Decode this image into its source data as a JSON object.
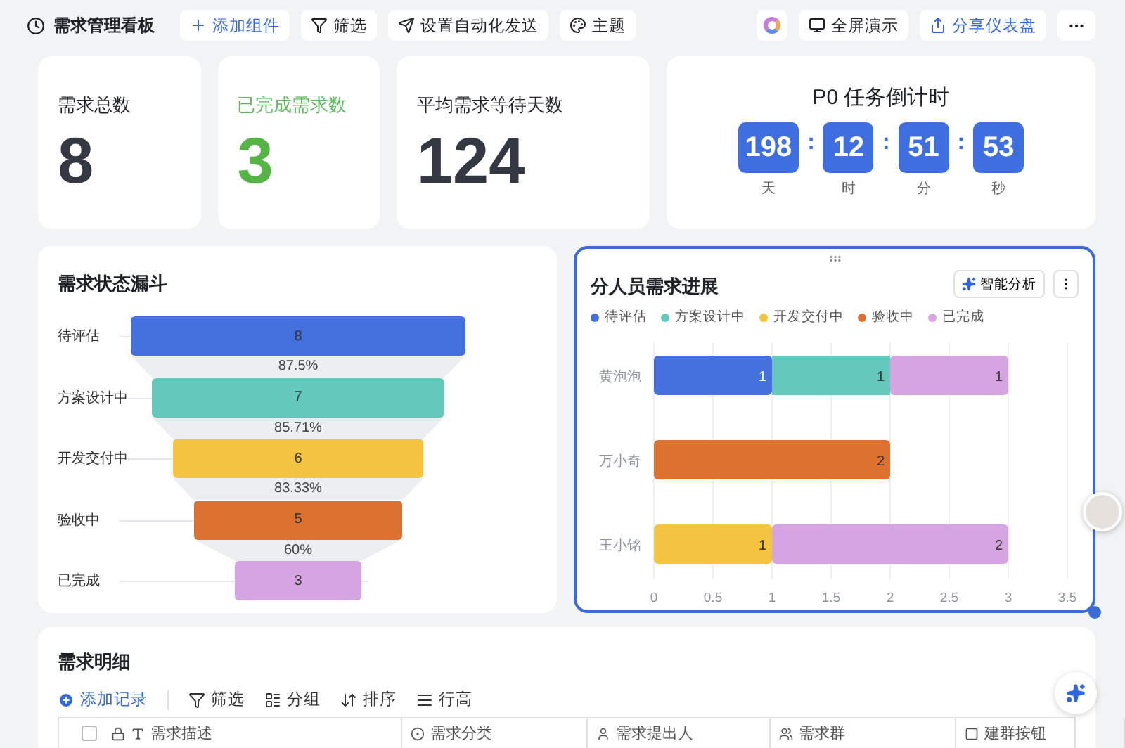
{
  "toolbar": {
    "title": "需求管理看板",
    "left_buttons": [
      {
        "kind": "add",
        "label": "添加组件"
      },
      {
        "kind": "filter",
        "label": "筛选"
      },
      {
        "kind": "auto",
        "label": "设置自动化发送"
      },
      {
        "kind": "theme",
        "label": "主题"
      }
    ],
    "right_buttons": [
      {
        "kind": "present",
        "label": "全屏演示"
      },
      {
        "kind": "share",
        "label": "分享仪表盘"
      }
    ]
  },
  "stats": [
    {
      "label": "需求总数",
      "value": "8",
      "kind": "plain"
    },
    {
      "label": "已完成需求数",
      "value": "3",
      "kind": "success"
    },
    {
      "label": "平均需求等待天数",
      "value": "124",
      "kind": "plain"
    }
  ],
  "countdown": {
    "title": "P0 任务倒计时",
    "separator": ":",
    "units": [
      {
        "value": "198",
        "unit": "天"
      },
      {
        "value": "12",
        "unit": "时"
      },
      {
        "value": "51",
        "unit": "分"
      },
      {
        "value": "53",
        "unit": "秒"
      }
    ]
  },
  "funnel": {
    "title": "需求状态漏斗",
    "stages": [
      {
        "label": "待评估",
        "value": "8",
        "color": "#4470de",
        "conversion": "87.5%"
      },
      {
        "label": "方案设计中",
        "value": "7",
        "color": "#62c9bc",
        "conversion": "85.71%"
      },
      {
        "label": "开发交付中",
        "value": "6",
        "color": "#f5c542",
        "conversion": "83.33%"
      },
      {
        "label": "验收中",
        "value": "5",
        "color": "#dd7230",
        "conversion": "60%"
      },
      {
        "label": "已完成",
        "value": "3",
        "color": "#d4a5e0"
      }
    ]
  },
  "progress": {
    "title": "分人员需求进展",
    "ai_button": "智能分析",
    "selected": true,
    "chart_data": {
      "type": "bar",
      "orientation": "horizontal",
      "stacked": true,
      "data_labels": true,
      "categories": [
        "黄泡泡",
        "万小奇",
        "王小铭"
      ],
      "series": [
        {
          "name": "待评估",
          "color": "#4470de",
          "values": [
            1,
            null,
            null
          ]
        },
        {
          "name": "方案设计中",
          "color": "#62c9bc",
          "values": [
            1,
            null,
            null
          ]
        },
        {
          "name": "开发交付中",
          "color": "#f5c542",
          "values": [
            null,
            null,
            1
          ]
        },
        {
          "name": "验收中",
          "color": "#dd7230",
          "values": [
            null,
            2,
            null
          ]
        },
        {
          "name": "已完成",
          "color": "#d4a5e0",
          "values": [
            1,
            null,
            2
          ]
        }
      ],
      "grid": true,
      "xlim": [
        0,
        3.5
      ],
      "xticks": [
        0,
        0.5,
        1,
        1.5,
        2,
        2.5,
        3,
        3.5
      ]
    }
  },
  "details": {
    "title": "需求明细",
    "select_all_checked": false,
    "actions": [
      {
        "kind": "add",
        "label": "添加记录"
      },
      {
        "kind": "filter",
        "label": "筛选"
      },
      {
        "kind": "group",
        "label": "分组"
      },
      {
        "kind": "sort",
        "label": "排序"
      },
      {
        "kind": "height",
        "label": "行高"
      }
    ],
    "columns": [
      {
        "kind": "text",
        "label": "需求描述"
      },
      {
        "kind": "select",
        "label": "需求分类"
      },
      {
        "kind": "person",
        "label": "需求提出人"
      },
      {
        "kind": "group",
        "label": "需求群"
      },
      {
        "kind": "button",
        "label": "建群按钮"
      }
    ]
  }
}
